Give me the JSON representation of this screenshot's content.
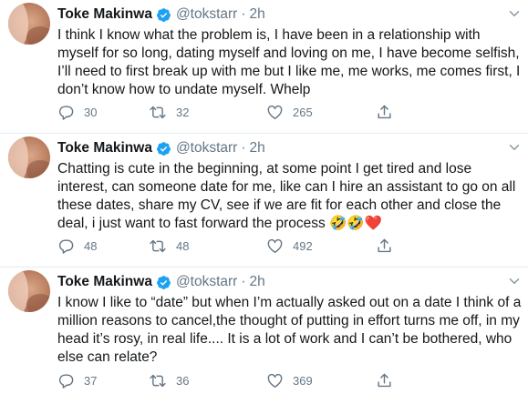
{
  "tweets": [
    {
      "name": "Toke Makinwa",
      "handle": "@tokstarr",
      "dot": "·",
      "time": "2h",
      "text": "I think I know what the problem is, I have been in a relationship with myself for so long, dating myself and loving on me, I have become selfish, I’ll need to first break up with me but I like me, me works, me comes first, I don’t know how to undate myself. Whelp",
      "replies": "30",
      "retweets": "32",
      "likes": "265"
    },
    {
      "name": "Toke Makinwa",
      "handle": "@tokstarr",
      "dot": "·",
      "time": "2h",
      "text": "Chatting is cute in the beginning, at some point I get tired and lose interest, can someone date for me, like can I hire an assistant to go on all these dates, share my CV, see if we are fit for each other and close the deal, i just want to fast forward the process 🤣🤣❤️",
      "replies": "48",
      "retweets": "48",
      "likes": "492"
    },
    {
      "name": "Toke Makinwa",
      "handle": "@tokstarr",
      "dot": "·",
      "time": "2h",
      "text": "I know I like to “date” but when I’m actually asked out on a date I think of a million reasons to cancel,the thought of putting in effort turns me off, in my head it’s rosy, in real life.... It is a lot of work and I can’t be bothered, who else can relate?",
      "replies": "37",
      "retweets": "36",
      "likes": "369"
    }
  ],
  "icons": {
    "verified": "verified-badge-icon",
    "caret": "chevron-down-icon",
    "reply": "reply-icon",
    "retweet": "retweet-icon",
    "like": "heart-icon",
    "share": "share-icon"
  },
  "colors": {
    "text": "#14171a",
    "muted": "#657786",
    "verified": "#1da1f2",
    "divider": "#e6ecf0"
  }
}
